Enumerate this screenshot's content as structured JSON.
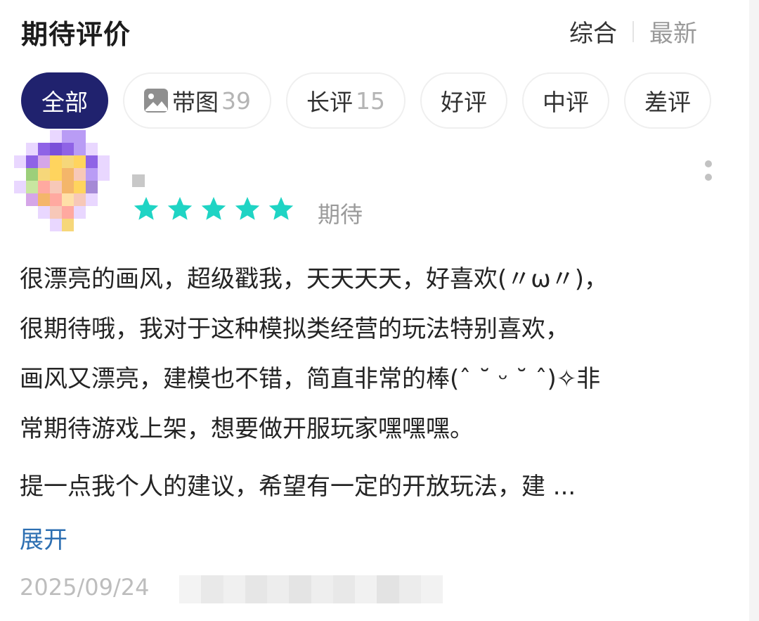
{
  "header": {
    "title": "期待评价",
    "sort_options": [
      {
        "label": "综合",
        "active": true
      },
      {
        "label": "最新",
        "active": false
      }
    ]
  },
  "filters": [
    {
      "label": "全部",
      "count": "",
      "active": true,
      "icon": ""
    },
    {
      "label": "带图",
      "count": "39",
      "active": false,
      "icon": "image-icon"
    },
    {
      "label": "长评",
      "count": "15",
      "active": false,
      "icon": ""
    },
    {
      "label": "好评",
      "count": "",
      "active": false,
      "icon": ""
    },
    {
      "label": "中评",
      "count": "",
      "active": false,
      "icon": ""
    },
    {
      "label": "差评",
      "count": "",
      "active": false,
      "icon": ""
    }
  ],
  "review": {
    "rating": 5,
    "rating_max": 5,
    "star_color": "#1fd4c4",
    "rating_label": "期待",
    "paragraph1_lines": [
      "很漂亮的画风，超级戳我，天天天天，好喜欢(〃ω〃)，",
      "很期待哦，我对于这种模拟类经营的玩法特别喜欢，",
      "画风又漂亮，建模也不错，简直非常的棒(ˆ ˘ ᵕ ˘ ˆ)✧非",
      "常期待游戏上架，想要做开服玩家嘿嘿嘿。"
    ],
    "paragraph2": "提一点我个人的建议，希望有一定的开放玩法，建 ...",
    "expand_label": "展开",
    "date": "2025/09/24"
  },
  "colors": {
    "active_chip_bg": "#20226e",
    "link": "#2d6fb2"
  }
}
